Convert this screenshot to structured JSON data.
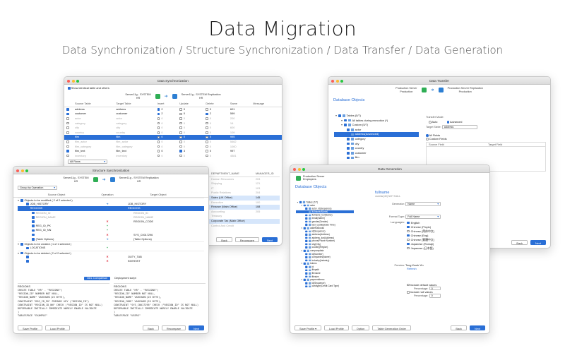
{
  "hero": {
    "title": "Data Migration",
    "subtitle": "Data Synchronization / Structure Synchronization / Data Transfer / Data Generation"
  },
  "sync": {
    "title": "Data Synchronization",
    "show_identical": "Show identical table and others",
    "source": {
      "name": "Server11g - SYSTEM",
      "schema": "HR"
    },
    "target": {
      "name": "Server11g - SYSTEM Replication",
      "schema": "HR"
    },
    "columns": [
      "Source Table",
      "Target Table",
      "Insert",
      "Update",
      "Delete",
      "Same",
      "Message"
    ],
    "rows": [
      {
        "src": "address",
        "tgt": "address",
        "ins": "2",
        "upd": "0",
        "del": "0",
        "same": "601",
        "on": true,
        "dim": false
      },
      {
        "src": "customer",
        "tgt": "customer",
        "ins": "2",
        "upd": "0",
        "del": "2",
        "same": "599",
        "on": true,
        "dim": false
      },
      {
        "src": "actor",
        "tgt": "actor",
        "ins": "0",
        "upd": "0",
        "del": "0",
        "same": "200",
        "on": false,
        "dim": true
      },
      {
        "src": "category",
        "tgt": "category",
        "ins": "0",
        "upd": "0",
        "del": "0",
        "same": "16",
        "on": false,
        "dim": true
      },
      {
        "src": "city",
        "tgt": "city",
        "ins": "0",
        "upd": "0",
        "del": "0",
        "same": "600",
        "on": false,
        "dim": true
      },
      {
        "src": "country",
        "tgt": "country",
        "ins": "0",
        "upd": "0",
        "del": "0",
        "same": "109",
        "on": false,
        "dim": true
      },
      {
        "src": "film",
        "tgt": "film",
        "ins": "0",
        "upd": "0",
        "del": "0",
        "same": "995",
        "on": true,
        "dim": false,
        "sel": true
      },
      {
        "src": "film_actor",
        "tgt": "film_actor",
        "ins": "0",
        "upd": "0",
        "del": "0",
        "same": "5462",
        "on": false,
        "dim": true
      },
      {
        "src": "film_category",
        "tgt": "film_category",
        "ins": "0",
        "upd": "0",
        "del": "0",
        "same": "1000",
        "on": false,
        "dim": true
      },
      {
        "src": "film_text",
        "tgt": "film_text",
        "ins": "0",
        "upd": "3",
        "del": "0",
        "same": "997",
        "on": true,
        "dim": false
      },
      {
        "src": "inventory",
        "tgt": "inventory",
        "ins": "0",
        "upd": "0",
        "del": "0",
        "same": "4581",
        "on": false,
        "dim": true
      }
    ],
    "filter": "All Rows",
    "result_columns": [
      "DEPARTMENT_NAME",
      "MANAGER_ID"
    ],
    "result_rows": [
      {
        "name": "Human Resources",
        "mgr": "203",
        "hl": false,
        "dim": true
      },
      {
        "name": "Shipping",
        "mgr": "121",
        "hl": false,
        "dim": true
      },
      {
        "name": "IT",
        "mgr": "103",
        "hl": false,
        "dim": true
      },
      {
        "name": "Public Relations",
        "mgr": "204",
        "hl": false,
        "dim": true
      },
      {
        "name": "Sales (UK Office)",
        "mgr": "145",
        "hl": true,
        "dim": false
      },
      {
        "name": "Executive",
        "mgr": "100",
        "hl": false,
        "dim": true
      },
      {
        "name": "Finance (Main Office)",
        "mgr": "108",
        "hl": true,
        "dim": false
      },
      {
        "name": "Accounting",
        "mgr": "205",
        "hl": false,
        "dim": true
      },
      {
        "name": "Treasury",
        "mgr": "",
        "hl": false,
        "dim": true
      },
      {
        "name": "Corporate Tax (Main Office)",
        "mgr": "",
        "hl": true,
        "dim": false
      },
      {
        "name": "Control And Credit",
        "mgr": "",
        "hl": false,
        "dim": true
      }
    ],
    "back": "Back",
    "recompare": "Recompare",
    "next": "Next"
  },
  "struct": {
    "title": "Structure Synchronization",
    "source": {
      "name": "Server11g - SYSTEM",
      "schema": "HR"
    },
    "target": {
      "name": "Server11g - SYSTEM Replication",
      "schema": "HR"
    },
    "group_by": "Group by Operation",
    "col_source": "Source Object",
    "col_operation": "Operation",
    "col_target": "Target Object",
    "modified_header": "Objects to be modified ( 2 of 2 selected )",
    "modified": [
      {
        "label": "JOB_HISTORY",
        "target": "JOB_HISTORY",
        "op": "arrow",
        "indent": 1,
        "sel": false
      },
      {
        "label": "REGIONS",
        "target": "REGIONS",
        "op": "arrow",
        "indent": 1,
        "sel": true
      },
      {
        "label": "REGION_ID",
        "target": "REGION_ID",
        "op": "",
        "indent": 2,
        "sel": false,
        "dim": true
      },
      {
        "label": "REGION_NAME",
        "target": "REGION_NAME",
        "op": "",
        "indent": 2,
        "sel": false,
        "dim": true
      },
      {
        "label": "",
        "target": "REGION_CODE",
        "op": "x",
        "indent": 2,
        "sel": false
      },
      {
        "label": "REG_ID_PK",
        "target": "",
        "op": "plus",
        "indent": 2,
        "sel": false
      },
      {
        "label": "REG_ID_NN",
        "target": "",
        "op": "plus",
        "indent": 2,
        "sel": false
      },
      {
        "label": "",
        "target": "SYS_C0017296",
        "op": "x",
        "indent": 2,
        "sel": false
      },
      {
        "label": "(Table Options)",
        "target": "(Table Options)",
        "op": "arrow",
        "indent": 2,
        "sel": false
      }
    ],
    "created_header": "Objects to be created ( 1 of 1 selected )",
    "created": [
      {
        "label": "LOCATIONS",
        "target": "",
        "op": "plus"
      }
    ],
    "deleted_header": "Objects to be deleted ( 2 of 2 selected )",
    "deleted": [
      {
        "label": "",
        "target": "OUTY_TAB",
        "op": "x"
      },
      {
        "label": "",
        "target": "INVHEIST",
        "op": "x"
      }
    ],
    "tab_ddl": "DDL Comparison",
    "tab_script": "Deployment script",
    "ddl_left_title": "REGIONS",
    "ddl_right_title": "REGIONS",
    "ddl_left": [
      "CREATE TABLE \"HR\" . \"REGIONS\"(",
      "  \"REGION_ID\" NUMBER NOT NULL,",
      "  \"REGION_NAME\" VARCHAR2(25 BYTE),",
      "  CONSTRAINT \"REG_ID_PK\" PRIMARY KEY (\"REGION_ID\")",
      "  CONSTRAINT \"REGION_ID_NN\" CHECK (\"REGION_ID\" IS NOT NULL)",
      "  DEFERRABLE INITIALLY IMMEDIATE NORELY ENABLE VALIDATE",
      ")",
      "TABLESPACE \"EXAMPLE\""
    ],
    "ddl_right": [
      "CREATE TABLE \"HR\" . \"REGIONS\"(",
      "  \"REGION_ID\" NUMBER NOT NULL,",
      "  \"REGION_NAME\" VARCHAR2(25 BYTE),",
      "  \"REGION_CODE\" VARCHAR2(25 BYTE),",
      "  CONSTRAINT \"SYS_C0017296\" CHECK (\"REGION_ID\" IS NOT NULL)",
      "  DEFERRABLE INITIALLY IMMEDIATE NORELY ENABLE VALIDATE",
      ")",
      "TABLESPACE \"USERS\""
    ],
    "save_profile": "Save Profile",
    "load_profile": "Load Profile",
    "back": "Back",
    "recompare": "Recompare",
    "next": "Next"
  },
  "transfer": {
    "title": "Data Transfer",
    "source": {
      "name": "Production Server",
      "schema": "Production"
    },
    "target": {
      "name": "Production Server Replication",
      "schema": "Production"
    },
    "heading": "Database Objects",
    "tree": [
      {
        "label": "Tables (5/7)",
        "indent": 0
      },
      {
        "label": "All tables during execution (*)",
        "indent": 1
      },
      {
        "label": "Custom (5/7)",
        "indent": 1
      },
      {
        "label": "actor",
        "indent": 2
      },
      {
        "label": "address(Advanced)",
        "indent": 2,
        "sel": true
      },
      {
        "label": "category",
        "indent": 2
      },
      {
        "label": "city",
        "indent": 2
      },
      {
        "label": "country",
        "indent": 2
      },
      {
        "label": "customer",
        "indent": 2
      },
      {
        "label": "film",
        "indent": 2
      }
    ],
    "transfer_mode": "Transfer Mode:",
    "mode_auto": "Auto",
    "mode_advanced": "Advanced",
    "target_table_label": "Target Table:",
    "target_table": "address",
    "all_fields": "All Fields",
    "custom_fields": "Custom Fields",
    "source_field": "Source Field",
    "target_field": "Target Field",
    "back": "Back",
    "next": "Next"
  },
  "gen": {
    "title": "Data Generation",
    "server": "Production Server",
    "schema": "Employees",
    "heading": "Database Objects",
    "tree": [
      {
        "label": "Tables (7/7)",
        "indent": 0
      },
      {
        "label": "actor",
        "indent": 1
      },
      {
        "label": "actor_id(Sequence)",
        "indent": 2
      },
      {
        "label": "fullname(Name)",
        "indent": 2,
        "sel": true
      },
      {
        "label": "fullname_kor(Name)",
        "indent": 2
      },
      {
        "label": "email(Name)",
        "indent": 2
      },
      {
        "label": "gender(Gender)",
        "indent": 2
      },
      {
        "label": "last_update(Date Time)",
        "indent": 2
      },
      {
        "label": "addressbooks",
        "indent": 1
      },
      {
        "label": "id(Sequence)",
        "indent": 2
      },
      {
        "label": "address(Address)",
        "indent": 2
      },
      {
        "label": "address_kor(Address)",
        "indent": 2
      },
      {
        "label": "phone(Phone Number)",
        "indent": 2
      },
      {
        "label": "city(City)",
        "indent": 2
      },
      {
        "label": "country(Region)",
        "indent": 2
      },
      {
        "label": "companydata",
        "indent": 1
      },
      {
        "label": "id(Number)",
        "indent": 2
      },
      {
        "label": "companies(Name)",
        "indent": 2
      },
      {
        "label": "industry(Industry)",
        "indent": 2
      },
      {
        "label": "tokens",
        "indent": 1
      },
      {
        "label": "id",
        "indent": 2
      },
      {
        "label": "filepath",
        "indent": 2
      },
      {
        "label": "filename",
        "indent": 2
      },
      {
        "label": "filesize",
        "indent": 2
      },
      {
        "label": "paymentdemo",
        "indent": 1
      },
      {
        "label": "id(Sequence)",
        "indent": 2
      },
      {
        "label": "cardtype(Credit Card Type)",
        "indent": 2
      }
    ],
    "field_title": "fullname",
    "field_sub": "varchar(40) NOT NULL",
    "generator_label": "Generator:",
    "generator": "Name",
    "format_label": "Format Type:",
    "format": "Full Name",
    "languages_label": "Languages:",
    "languages": [
      {
        "label": "English",
        "on": true
      },
      {
        "label": "Chinese (Pinyin)",
        "on": true
      },
      {
        "label": "Chinese (简体中文)",
        "on": false
      },
      {
        "label": "Chinese (Eng)",
        "on": true
      },
      {
        "label": "Chinese (繁體中文)",
        "on": false
      },
      {
        "label": "Japanese (Romaji)",
        "on": true
      },
      {
        "label": "Japanese (日本語)",
        "on": false
      }
    ],
    "preview_label": "Preview:",
    "preview": "Tong Kwok Yin",
    "refresh": "Refresh",
    "include_default": "Include default values",
    "percentage_label": "Percentage:",
    "pct1": "0",
    "include_null": "Include null values",
    "pct2": "0",
    "save_profile": "Save Profile",
    "load_profile": "Load Profile",
    "option": "Option",
    "table_order": "Table Generation Order",
    "back": "Back",
    "next": "Next"
  }
}
